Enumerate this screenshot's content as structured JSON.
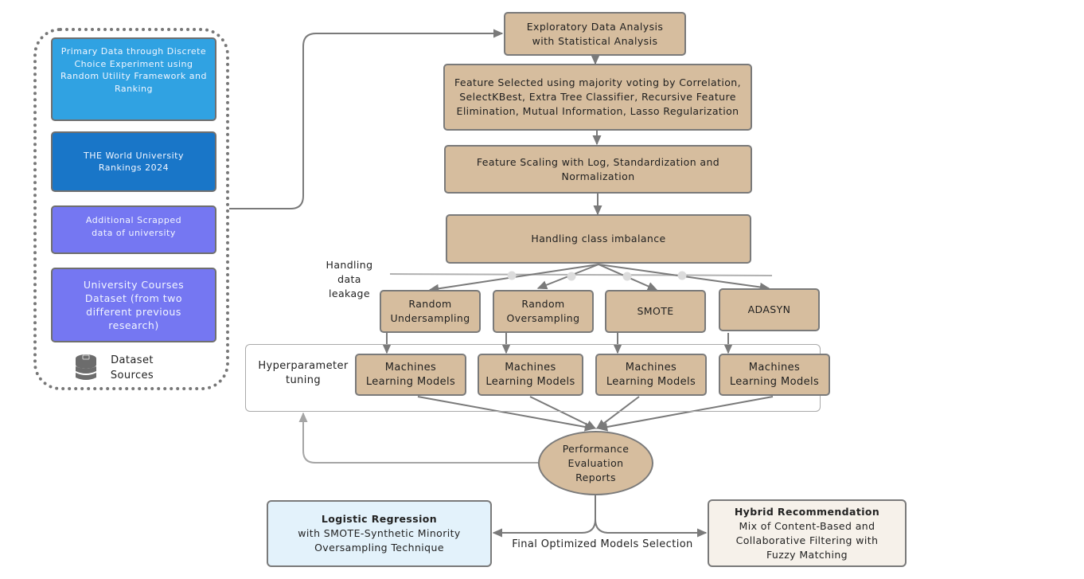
{
  "sources": {
    "items": [
      {
        "label": "Primary Data through Discrete Choice Experiment using Random Utility Framework and Ranking",
        "color": "#30a2e2"
      },
      {
        "label": "THE World University Rankings 2024",
        "color": "#1976c8"
      },
      {
        "label": "Additional Scrapped data of university",
        "color": "#7577f2"
      },
      {
        "label": "University Courses Dataset (from two different previous research)",
        "color": "#7577f2"
      }
    ],
    "caption_line1": "Dataset",
    "caption_line2": "Sources",
    "icon": "database-icon"
  },
  "pipeline": {
    "eda": "Exploratory Data Analysis with Statistical Analysis",
    "feature_selection": "Feature Selected using majority voting by Correlation, SelectKBest, Extra Tree Classifier, Recursive Feature Elimination, Mutual Information, Lasso Regularization",
    "feature_scaling": "Feature Scaling with Log, Standardization and Normalization",
    "class_imbalance": "Handling class imbalance",
    "leakage_label_line1": "Handling data",
    "leakage_label_line2": "leakage",
    "resampling": [
      "Random Undersampling",
      "Random Oversampling",
      "SMOTE",
      "ADASYN"
    ],
    "hyperparameter_label_line1": "Hyperparameter",
    "hyperparameter_label_line2": "tuning",
    "models": [
      "Machines Learning Models",
      "Machines Learning Models",
      "Machines Learning Models",
      "Machines Learning Models"
    ],
    "evaluation": "Performance Evaluation Reports",
    "final_selection_label": "Final Optimized Models Selection"
  },
  "outputs": {
    "left": {
      "title": "Logistic Regression",
      "line1": "with SMOTE-Synthetic Minority",
      "line2": "Oversampling Technique",
      "color": "#e3f2fb"
    },
    "right": {
      "title": "Hybrid Recommendation",
      "line1": "Mix of Content-Based  and",
      "line2": "Collaborative Filtering with",
      "line3": "Fuzzy Matching",
      "color": "#f6f1ea"
    }
  },
  "colors": {
    "process_box": "#d6bd9e",
    "border": "#7a7a7a",
    "connector": "#7a7a7a"
  }
}
